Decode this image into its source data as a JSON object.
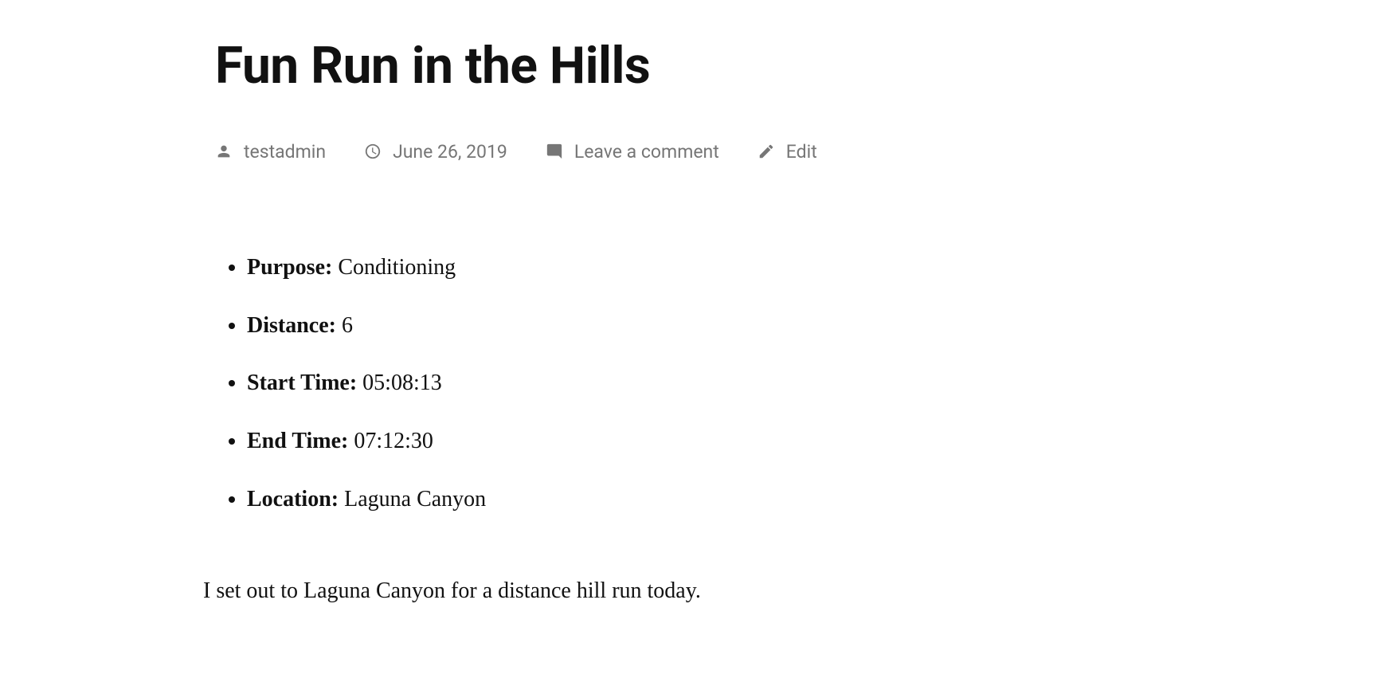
{
  "post": {
    "title": "Fun Run in the Hills",
    "author": "testadmin",
    "date": "June 26, 2019",
    "comments_label": "Leave a comment",
    "edit_label": "Edit"
  },
  "details": [
    {
      "label": "Purpose:",
      "value": "Conditioning"
    },
    {
      "label": "Distance:",
      "value": "6"
    },
    {
      "label": "Start Time:",
      "value": "05:08:13"
    },
    {
      "label": "End Time:",
      "value": "07:12:30"
    },
    {
      "label": "Location:",
      "value": "Laguna Canyon"
    }
  ],
  "body": "I set out to Laguna Canyon for a distance hill run today."
}
